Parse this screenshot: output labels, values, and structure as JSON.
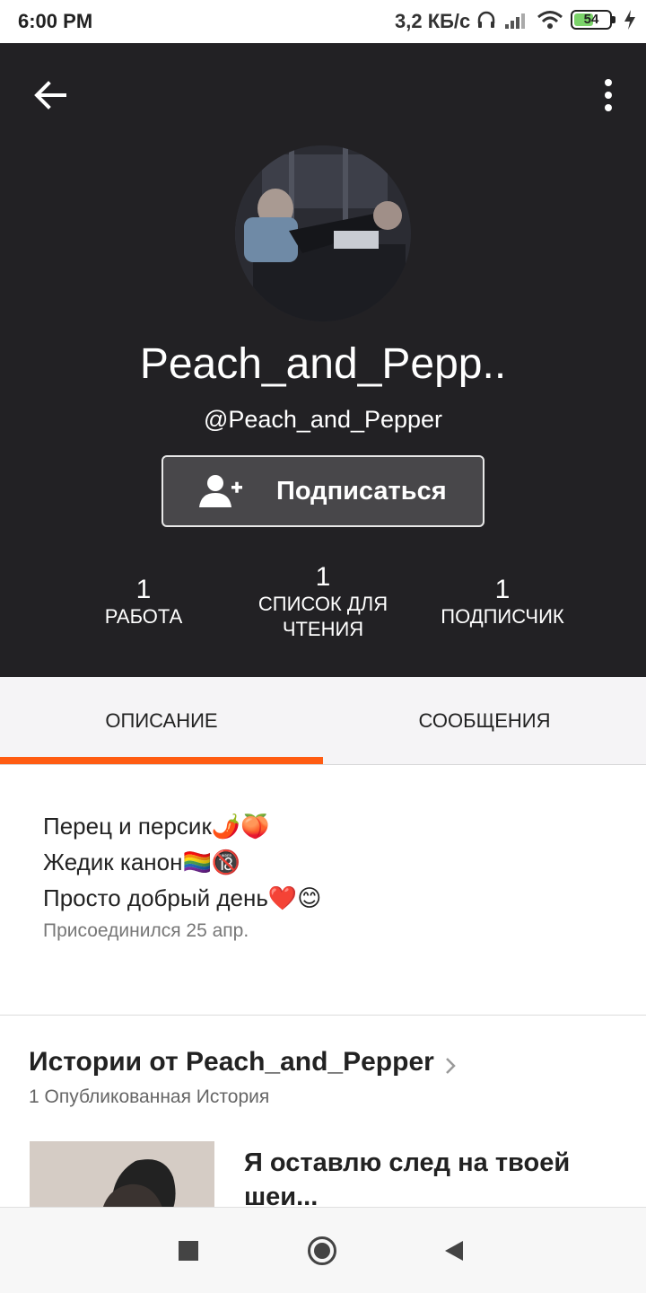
{
  "status_bar": {
    "time": "6:00 PM",
    "net_speed": "3,2 КБ/с",
    "battery": "54",
    "battery_level": 0.54
  },
  "header": {
    "back_icon": "arrow-left-icon",
    "menu_icon": "more-vertical-icon",
    "display_name": "Peach_and_Pepp..",
    "username": "@Peach_and_Pepper",
    "follow_label": "Подписаться",
    "follow_icon": "add-user-icon",
    "stats": {
      "works": {
        "value": "1",
        "label": "РАБОТА"
      },
      "reading_lists": {
        "value": "1",
        "label_line1": "СПИСОК ДЛЯ",
        "label_line2": "ЧТЕНИЯ"
      },
      "followers": {
        "value": "1",
        "label": "ПОДПИСЧИК"
      }
    }
  },
  "tabs": {
    "about": "ОПИСАНИЕ",
    "messages": "СООБЩЕНИЯ",
    "active": "about"
  },
  "about": {
    "lines": [
      "Перец и персик🌶️🍑",
      "Жедик канон🏳️‍🌈🔞",
      "Просто добрый день❤️😊"
    ],
    "joined": "Присоединился 25 апр."
  },
  "stories": {
    "title": "Истории от Peach_and_Pepper",
    "count": "1 Опубликованная История",
    "items": [
      {
        "title": "Я оставлю след на твоей шеи..."
      }
    ]
  },
  "nav_bar": {
    "icons": [
      "recent-apps-icon",
      "home-icon",
      "back-icon"
    ]
  },
  "colors": {
    "header_bg": "#222124",
    "accent": "#ff5c12",
    "tabs_bg": "#f5f4f6"
  }
}
